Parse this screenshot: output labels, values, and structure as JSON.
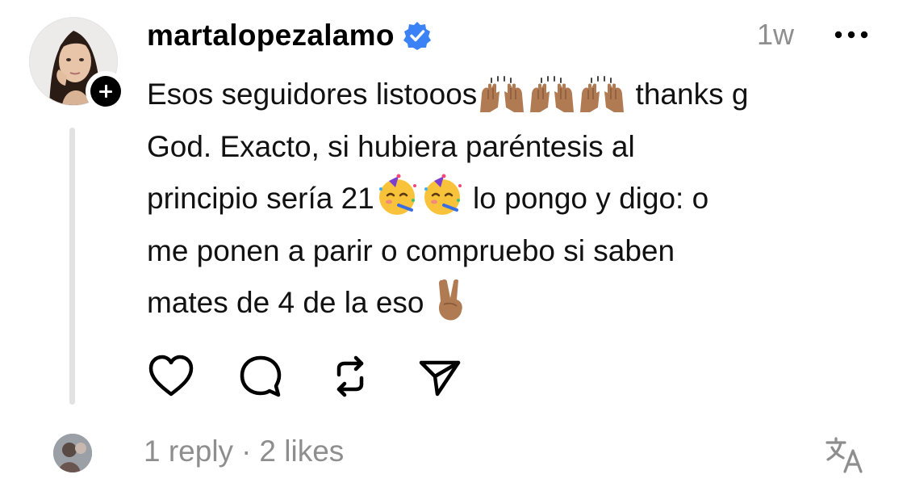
{
  "comment": {
    "username": "martalopezalamo",
    "verified": true,
    "time": "1w",
    "text_lines": [
      [
        "Esos seguidores listooos",
        "raising-hands-emoji",
        "raising-hands-emoji",
        "raising-hands-emoji",
        " thanks g"
      ],
      [
        "God. Exacto, si hubiera paréntesis al"
      ],
      [
        "principio sería 21",
        "partying-face-emoji",
        "partying-face-emoji",
        " lo pongo y digo: o"
      ],
      [
        "me ponen a parir o compruebo si saben"
      ],
      [
        "mates de 4 de la eso ",
        "victory-hand-emoji"
      ]
    ],
    "actions": [
      {
        "icon": "heart-icon"
      },
      {
        "icon": "comment-icon"
      },
      {
        "icon": "repost-icon"
      },
      {
        "icon": "share-icon"
      }
    ]
  },
  "footer": {
    "replies": "1 reply",
    "separator": "·",
    "likes": "2 likes",
    "translate_icon": "translate-icon"
  },
  "colors": {
    "verified_blue": "#3b82f6",
    "muted_text": "#8e8e8e",
    "thread_line": "#e2e2e2",
    "skin_tone": "#b07a52",
    "emoji_face": "#f8c33a"
  }
}
